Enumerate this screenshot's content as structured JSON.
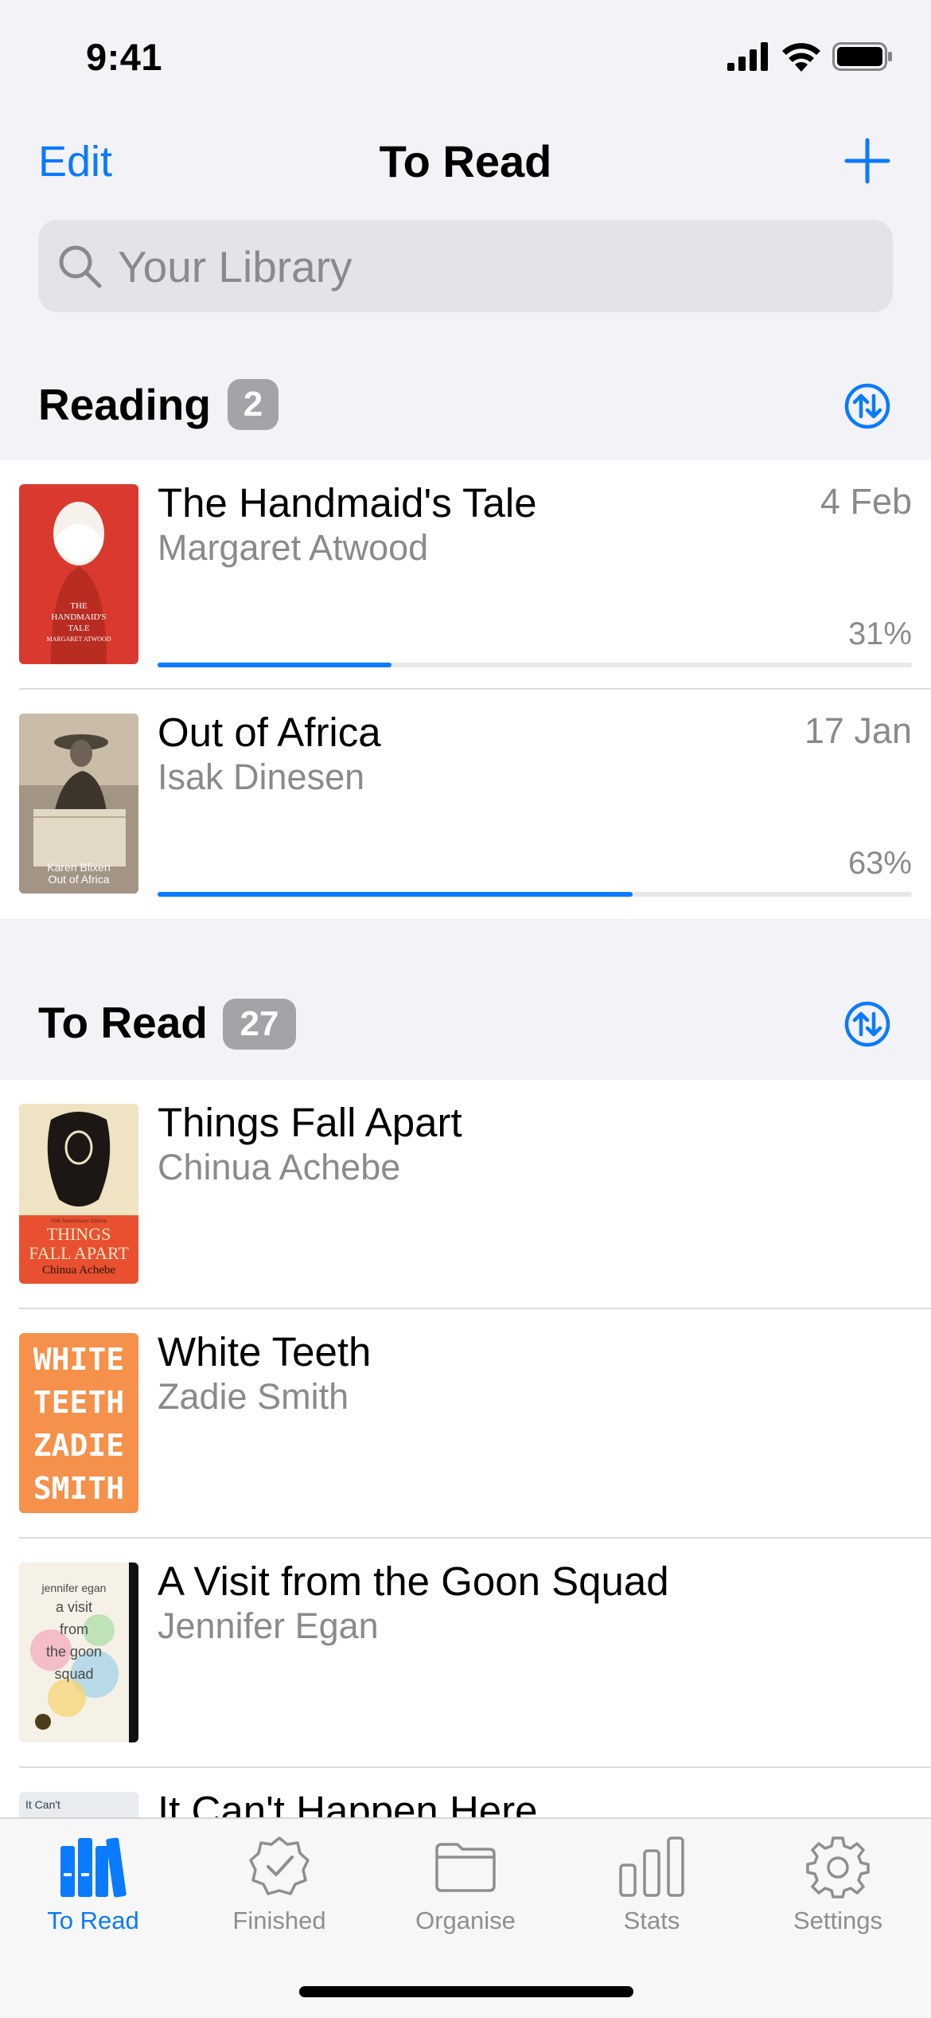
{
  "status": {
    "time": "9:41"
  },
  "nav": {
    "edit": "Edit",
    "title": "To Read"
  },
  "search": {
    "placeholder": "Your Library"
  },
  "sections": {
    "reading": {
      "title": "Reading",
      "count": "2"
    },
    "to_read": {
      "title": "To Read",
      "count": "27"
    }
  },
  "reading": [
    {
      "title": "The Handmaid's Tale",
      "author": "Margaret Atwood",
      "date": "4 Feb",
      "progress": "31%",
      "progress_value": 0.31,
      "cover": {
        "lines": [
          "THE",
          "HANDMAID'S",
          "TALE",
          "MARGARET ATWOOD"
        ],
        "bg": "#d9392e"
      }
    },
    {
      "title": "Out of Africa",
      "author": "Isak Dinesen",
      "date": "17 Jan",
      "progress": "63%",
      "progress_value": 0.63,
      "cover": {
        "lines": [
          "Karen Blixen",
          "Out of Africa"
        ],
        "bg": "#8b7d6b"
      }
    }
  ],
  "to_read": [
    {
      "title": "Things Fall Apart",
      "author": "Chinua Achebe",
      "cover": {
        "lines": [
          "50th Anniversary Edition",
          "THINGS",
          "FALL APART",
          "Chinua Achebe"
        ],
        "bg": "#e8502f"
      }
    },
    {
      "title": "White Teeth",
      "author": "Zadie Smith",
      "cover": {
        "lines": [
          "WHITE",
          "TEETH",
          "ZADIE",
          "SMITH"
        ],
        "bg": "#f5914a"
      }
    },
    {
      "title": "A Visit from the Goon Squad",
      "author": "Jennifer Egan",
      "cover": {
        "lines": [
          "jennifer egan",
          "a visit",
          "from",
          "the goon",
          "squad"
        ],
        "bg": "#f3efe3"
      }
    },
    {
      "title": "It Can't Happen Here",
      "author": "",
      "cover": {
        "lines": [
          "It Can't"
        ],
        "bg": "#e9ecef"
      }
    }
  ],
  "tabs": [
    {
      "label": "To Read",
      "icon": "books-icon"
    },
    {
      "label": "Finished",
      "icon": "checkmark-seal-icon"
    },
    {
      "label": "Organise",
      "icon": "folder-icon"
    },
    {
      "label": "Stats",
      "icon": "chart-bars-icon"
    },
    {
      "label": "Settings",
      "icon": "gear-icon"
    }
  ],
  "colors": {
    "accent": "#0a7aff",
    "secondary_text": "#8a8a8e",
    "background": "#f2f2f7"
  }
}
